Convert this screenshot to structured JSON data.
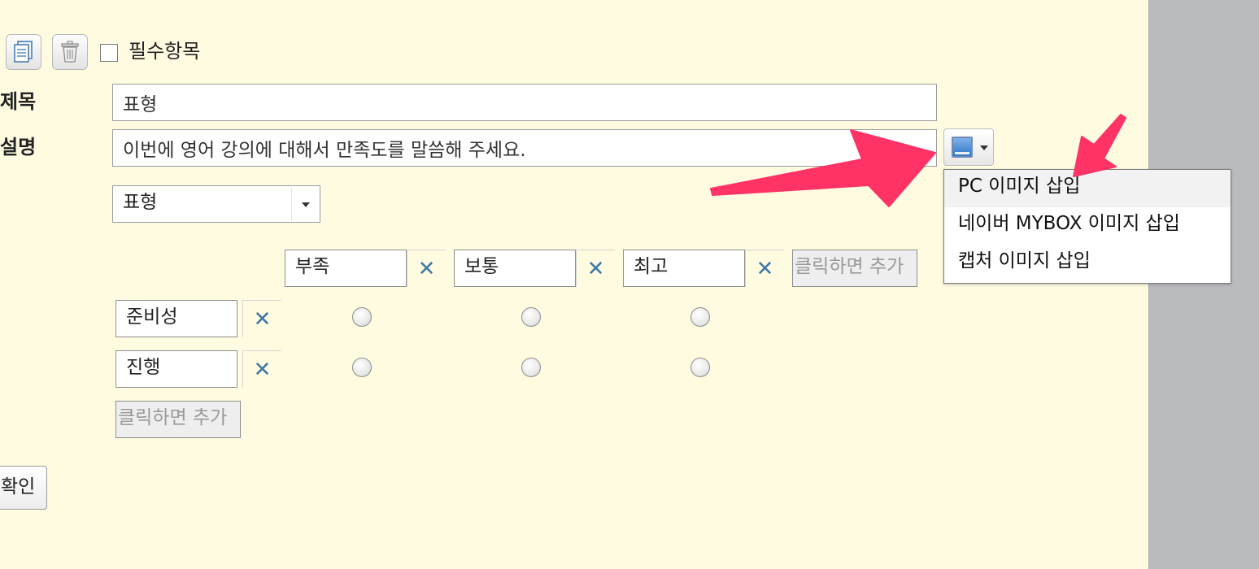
{
  "toolbar": {
    "copy_icon": "copy-icon",
    "delete_icon": "trash-icon",
    "required_label": "필수항목",
    "required_checked": false
  },
  "form": {
    "title_label": "제목",
    "title_value": "표형",
    "description_label": "설명",
    "description_value": "이번에 영어 강의에 대해서 만족도를 말씀해 주세요.",
    "type_select_value": "표형"
  },
  "image_menu": {
    "button_icon": "image-icon",
    "items": [
      "PC 이미지 삽입",
      "네이버 MYBOX 이미지 삽입",
      "캡처 이미지 삽입"
    ]
  },
  "grid": {
    "columns": [
      "부족",
      "보통",
      "최고"
    ],
    "rows": [
      "준비성",
      "진행"
    ],
    "add_column_label": "클릭하면 추가",
    "add_row_label": "클릭하면 추가",
    "remove_icon": "✕"
  },
  "confirm_label": "확인",
  "colors": {
    "background": "#fffbe0",
    "side_panel": "#b9bbbe",
    "remove_icon": "#3f78a8",
    "annotation_arrow": "#ff3366"
  }
}
